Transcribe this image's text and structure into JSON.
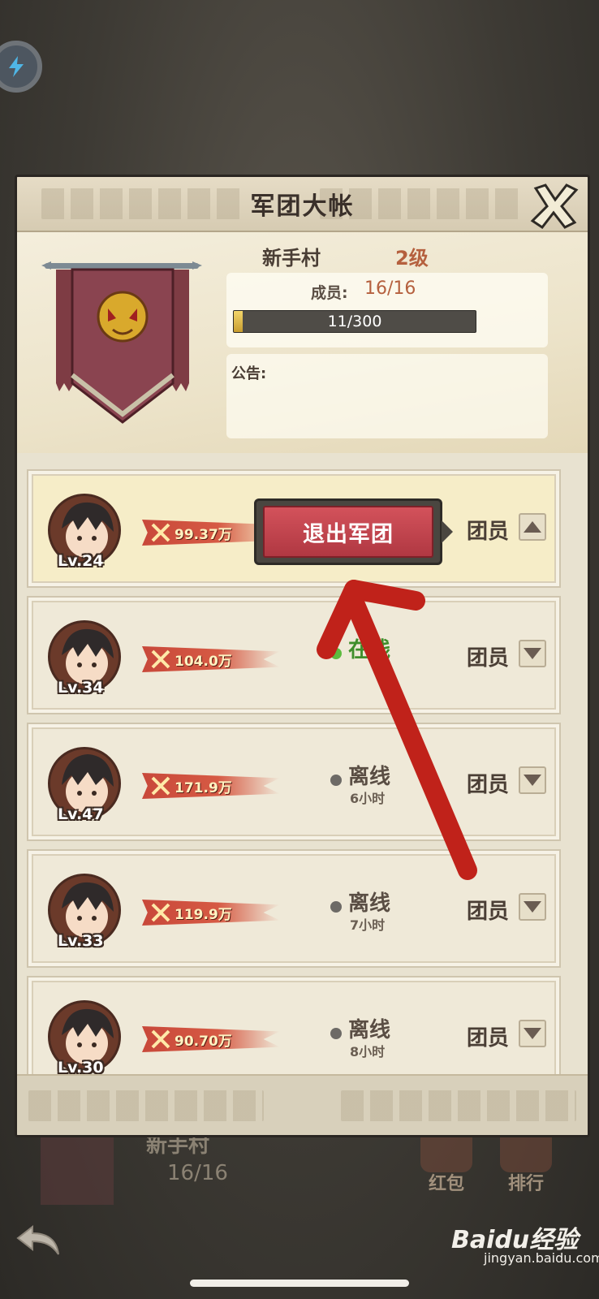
{
  "panel": {
    "title": "军团大帐"
  },
  "guild": {
    "name": "新手村",
    "level": "2级",
    "members_label": "成员:",
    "members_value": "16/16",
    "exp_text": "11/300",
    "exp_progress": 0.037,
    "notice_label": "公告:"
  },
  "popup": {
    "quit_label": "退出军团"
  },
  "members": [
    {
      "level": "Lv.24",
      "power": "99.37万",
      "status": "",
      "status_sub": "",
      "online": false,
      "role": "团员",
      "expanded": true
    },
    {
      "level": "Lv.34",
      "power": "104.0万",
      "status": "在线",
      "status_sub": "",
      "online": true,
      "role": "团员",
      "expanded": false
    },
    {
      "level": "Lv.47",
      "power": "171.9万",
      "status": "离线",
      "status_sub": "6小时",
      "online": false,
      "role": "团员",
      "expanded": false
    },
    {
      "level": "Lv.33",
      "power": "119.9万",
      "status": "离线",
      "status_sub": "7小时",
      "online": false,
      "role": "团员",
      "expanded": false
    },
    {
      "level": "Lv.30",
      "power": "90.70万",
      "status": "离线",
      "status_sub": "8小时",
      "online": false,
      "role": "团员",
      "expanded": false
    }
  ],
  "background": {
    "guild_name": "新手村",
    "member_count": "16/16",
    "hongbao_label": "红包",
    "rank_label": "排行"
  },
  "watermark": {
    "main": "Baidu经验",
    "sub": "jingyan.baidu.com"
  },
  "colors": {
    "accent_red": "#b03842",
    "online_green": "#5dbb3f",
    "arrow_red": "#c0221a"
  }
}
